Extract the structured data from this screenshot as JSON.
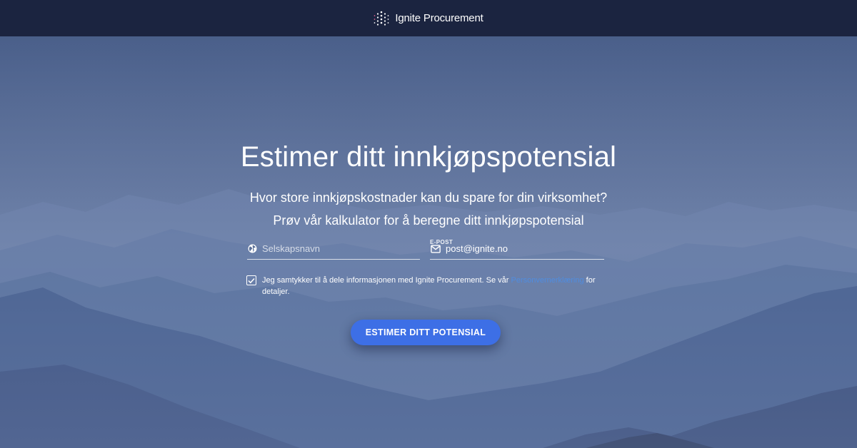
{
  "header": {
    "brand_name": "Ignite Procurement",
    "logo_icon": "dot-grid-logo-icon"
  },
  "hero": {
    "title": "Estimer ditt innkjøpspotensial",
    "subtitle_line1": "Hvor store innkjøpskostnader kan du spare for din virksomhet?",
    "subtitle_line2": "Prøv vår kalkulator for å beregne ditt innkjøpspotensial"
  },
  "form": {
    "company": {
      "placeholder": "Selskapsnavn",
      "value": "",
      "icon": "globe-icon"
    },
    "email": {
      "label": "E-POST",
      "value": "post@ignite.no",
      "icon": "envelope-icon"
    },
    "consent": {
      "checked": true,
      "text_before": "Jeg samtykker til å dele informasjonen med Ignite Procurement. Se vår ",
      "link_text": "Personvernerklæring",
      "text_after": " for detaljer."
    },
    "submit_label": "ESTIMER DITT POTENSIAL"
  },
  "colors": {
    "header_bg": "#1b2440",
    "button": "#3d6fe6",
    "link": "#4f8de0",
    "text": "#ffffff"
  }
}
